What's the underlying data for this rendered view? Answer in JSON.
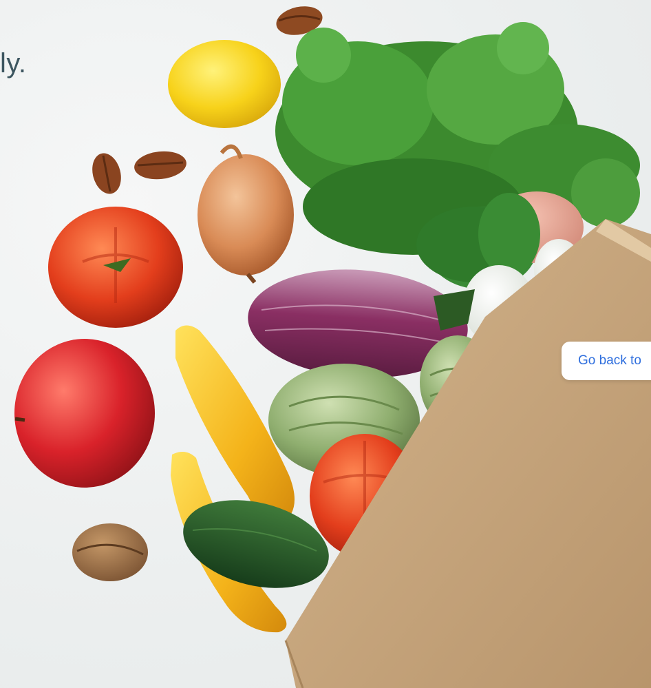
{
  "hero": {
    "headline_fragment": "ly.",
    "back_button_label": "Go back to"
  },
  "colors": {
    "background": "#eef0f0",
    "headline": "#3d5660",
    "button_text": "#2f6fde",
    "paper_bag": "#c7a57c"
  }
}
